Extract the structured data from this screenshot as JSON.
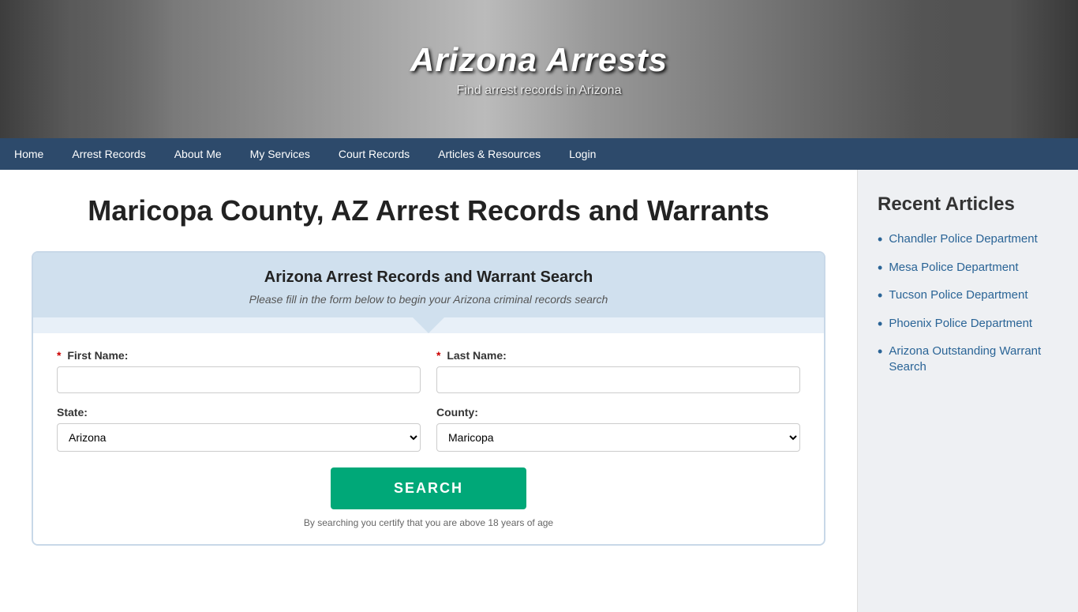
{
  "header": {
    "title": "Arizona Arrests",
    "subtitle": "Find arrest records in Arizona"
  },
  "nav": {
    "items": [
      {
        "label": "Home",
        "href": "#"
      },
      {
        "label": "Arrest Records",
        "href": "#"
      },
      {
        "label": "About Me",
        "href": "#"
      },
      {
        "label": "My Services",
        "href": "#"
      },
      {
        "label": "Court Records",
        "href": "#"
      },
      {
        "label": "Articles & Resources",
        "href": "#"
      },
      {
        "label": "Login",
        "href": "#"
      }
    ]
  },
  "main": {
    "page_title": "Maricopa County, AZ Arrest Records and Warrants",
    "search_box": {
      "title": "Arizona Arrest Records and Warrant Search",
      "subtitle": "Please fill in the form below to begin your Arizona criminal records search",
      "first_name_label": "First Name:",
      "last_name_label": "Last Name:",
      "state_label": "State:",
      "county_label": "County:",
      "state_default": "Arizona",
      "county_default": "Maricopa",
      "search_button": "SEARCH",
      "disclaimer": "By searching you certify that you are above 18 years of age"
    }
  },
  "sidebar": {
    "title": "Recent Articles",
    "items": [
      {
        "label": "Chandler Police Department",
        "href": "#"
      },
      {
        "label": "Mesa Police Department",
        "href": "#"
      },
      {
        "label": "Tucson Police Department",
        "href": "#"
      },
      {
        "label": "Phoenix Police Department",
        "href": "#"
      },
      {
        "label": "Arizona Outstanding Warrant Search",
        "href": "#"
      }
    ]
  }
}
